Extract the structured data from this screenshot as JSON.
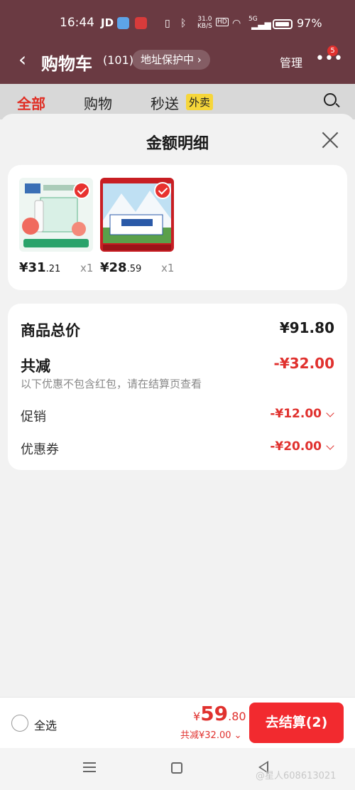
{
  "status_bar": {
    "time": "16:44",
    "carrier": "JD",
    "net_speed_value": "31.0",
    "net_speed_unit": "KB/S",
    "hd": "HD",
    "signal": "5G",
    "battery": "97%"
  },
  "header": {
    "title": "购物车",
    "count": "(101)",
    "address_pill": "地址保护中 ›",
    "manage": "管理",
    "badge": "5"
  },
  "tabs": [
    {
      "label": "全部"
    },
    {
      "label": "购物"
    },
    {
      "label": "秒送"
    }
  ],
  "tab_badge": "外卖",
  "sheet": {
    "title": "金额明细"
  },
  "products": [
    {
      "price_int": "¥31",
      "price_dec": ".21",
      "qty": "x1"
    },
    {
      "price_int": "¥28",
      "price_dec": ".59",
      "qty": "x1"
    }
  ],
  "summary": {
    "total_label": "商品总价",
    "total_value": "¥91.80",
    "discount_label": "共减",
    "discount_value": "-¥32.00",
    "note": "以下优惠不包含红包，请在结算页查看",
    "promo_label": "促销",
    "promo_value": "-¥12.00",
    "coupon_label": "优惠券",
    "coupon_value": "-¥20.00"
  },
  "bottom_bar": {
    "select_all": "全选",
    "currency": "¥",
    "total_int": "59",
    "total_dec": ".80",
    "discount_line": "共减¥32.00 ⌄",
    "checkout": "去结算(2)"
  },
  "watermark": "@星人608613021",
  "colors": {
    "accent_red": "#e0312e",
    "checkout_red": "#f22a2f",
    "header_bg": "#6a3a42"
  }
}
